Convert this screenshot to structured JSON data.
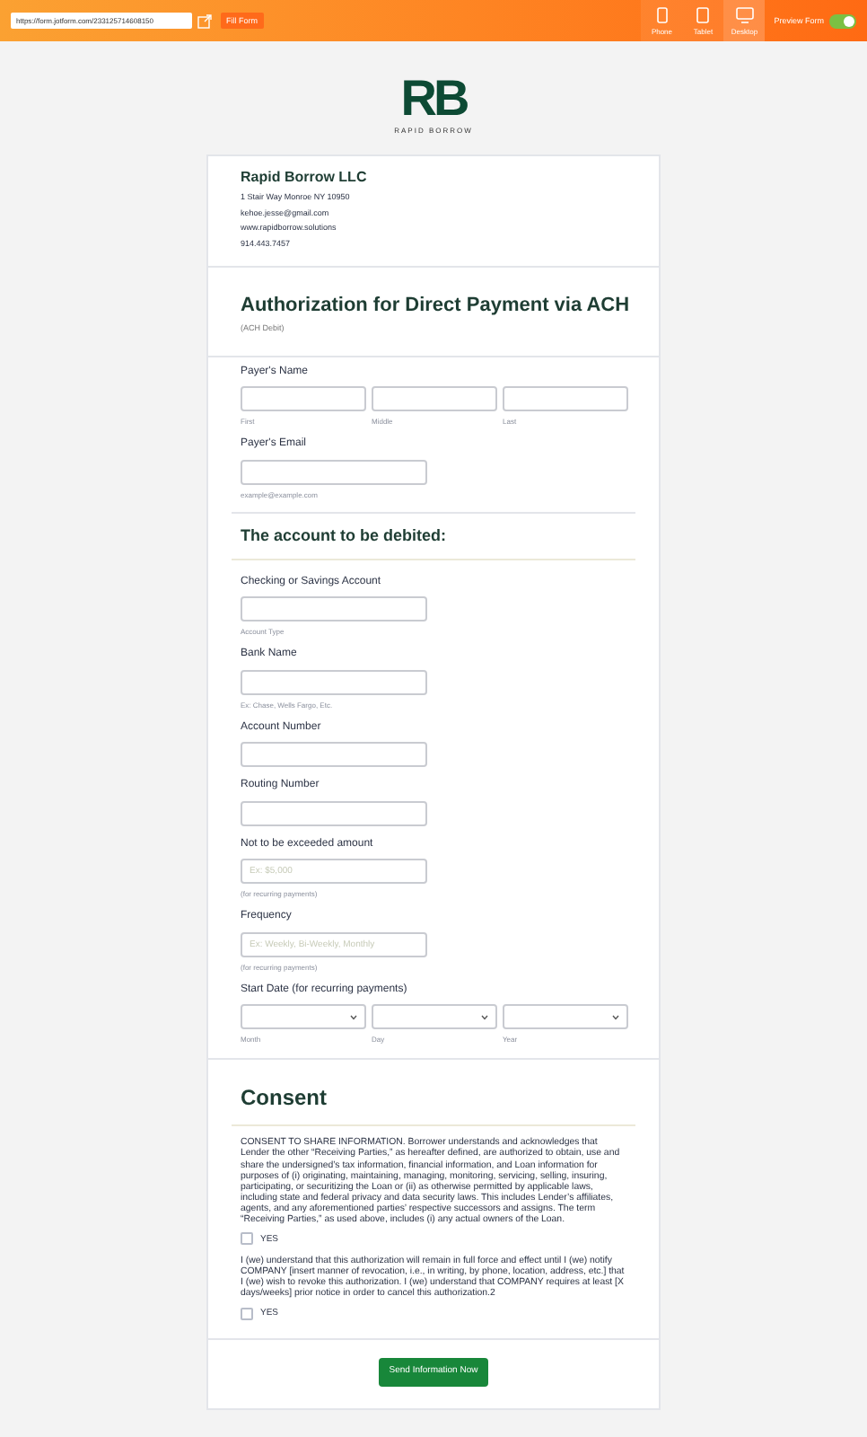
{
  "toolbar": {
    "url": "https://form.jotform.com/233125714608150",
    "fill_button": "Fill Form",
    "devices": [
      {
        "label": "Phone",
        "kind": "phone",
        "selected": false
      },
      {
        "label": "Tablet",
        "kind": "tablet",
        "selected": false
      },
      {
        "label": "Desktop",
        "kind": "desktop",
        "selected": true
      }
    ],
    "preview_toggle": {
      "label": "Preview Form",
      "on": true
    }
  },
  "logo": {
    "mark": "RB",
    "name": "RAPID BORROW"
  },
  "company": {
    "name": "Rapid Borrow LLC",
    "lines": [
      "1 Stair Way Monroe NY 10950",
      "kehoe.jesse@gmail.com",
      "www.rapidborrow.solutions",
      "914.443.7457"
    ]
  },
  "title": "Authorization for Direct Payment via ACH",
  "subtitle": "(ACH Debit)",
  "payer_fields": [
    {
      "kind": "multi",
      "label": "Payer's Name",
      "parts": [
        "First",
        "Middle",
        "Last"
      ]
    },
    {
      "kind": "text",
      "label": "Payer's Email",
      "sublabel": "example@example.com"
    }
  ],
  "account_heading": "The account to be debited:",
  "account_fields": [
    {
      "kind": "text",
      "label": "Checking or Savings Account",
      "sublabel": "Account Type"
    },
    {
      "kind": "text",
      "label": "Bank Name",
      "sublabel": "Ex: Chase, Wells Fargo, Etc."
    },
    {
      "kind": "text",
      "label": "Account Number"
    },
    {
      "kind": "text",
      "label": "Routing Number"
    },
    {
      "kind": "text",
      "label": "Not to be exceeded amount",
      "placeholder": "Ex: $5,000",
      "sublabel": "(for recurring payments)"
    },
    {
      "kind": "text",
      "label": "Frequency",
      "placeholder": "Ex: Weekly, Bi-Weekly, Monthly",
      "sublabel": "(for recurring payments)"
    },
    {
      "kind": "date",
      "label": "Start Date (for recurring payments)",
      "parts": [
        "Month",
        "Day",
        "Year"
      ]
    }
  ],
  "consent": {
    "heading": "Consent",
    "items": [
      {
        "text": "CONSENT TO SHARE INFORMATION. Borrower understands and acknowledges that Lender the other “Receiving Parties,” as hereafter defined, are authorized to obtain, use and share the undersigned’s tax information, financial information, and Loan information for purposes of (i) originating, maintaining, managing, monitoring, servicing, selling, insuring, participating, or securitizing the Loan or (ii) as otherwise permitted by applicable laws, including state and federal privacy and data security laws. This includes Lender’s affiliates, agents, and any aforementioned parties’ respective successors and assigns. The term “Receiving Parties,” as used above, includes (i) any actual owners of the Loan.",
        "option": "YES",
        "checked": false
      },
      {
        "text": "I (we) understand that this authorization will remain in full force and effect until I (we) notify COMPANY [insert manner of revocation, i.e., in writing, by phone, location, address, etc.] that I (we) wish to revoke this authorization. I (we) understand that COMPANY requires at least [X days/weeks] prior notice in order to cancel this authorization.2",
        "option": "YES",
        "checked": false
      }
    ]
  },
  "submit": "Send Information Now"
}
